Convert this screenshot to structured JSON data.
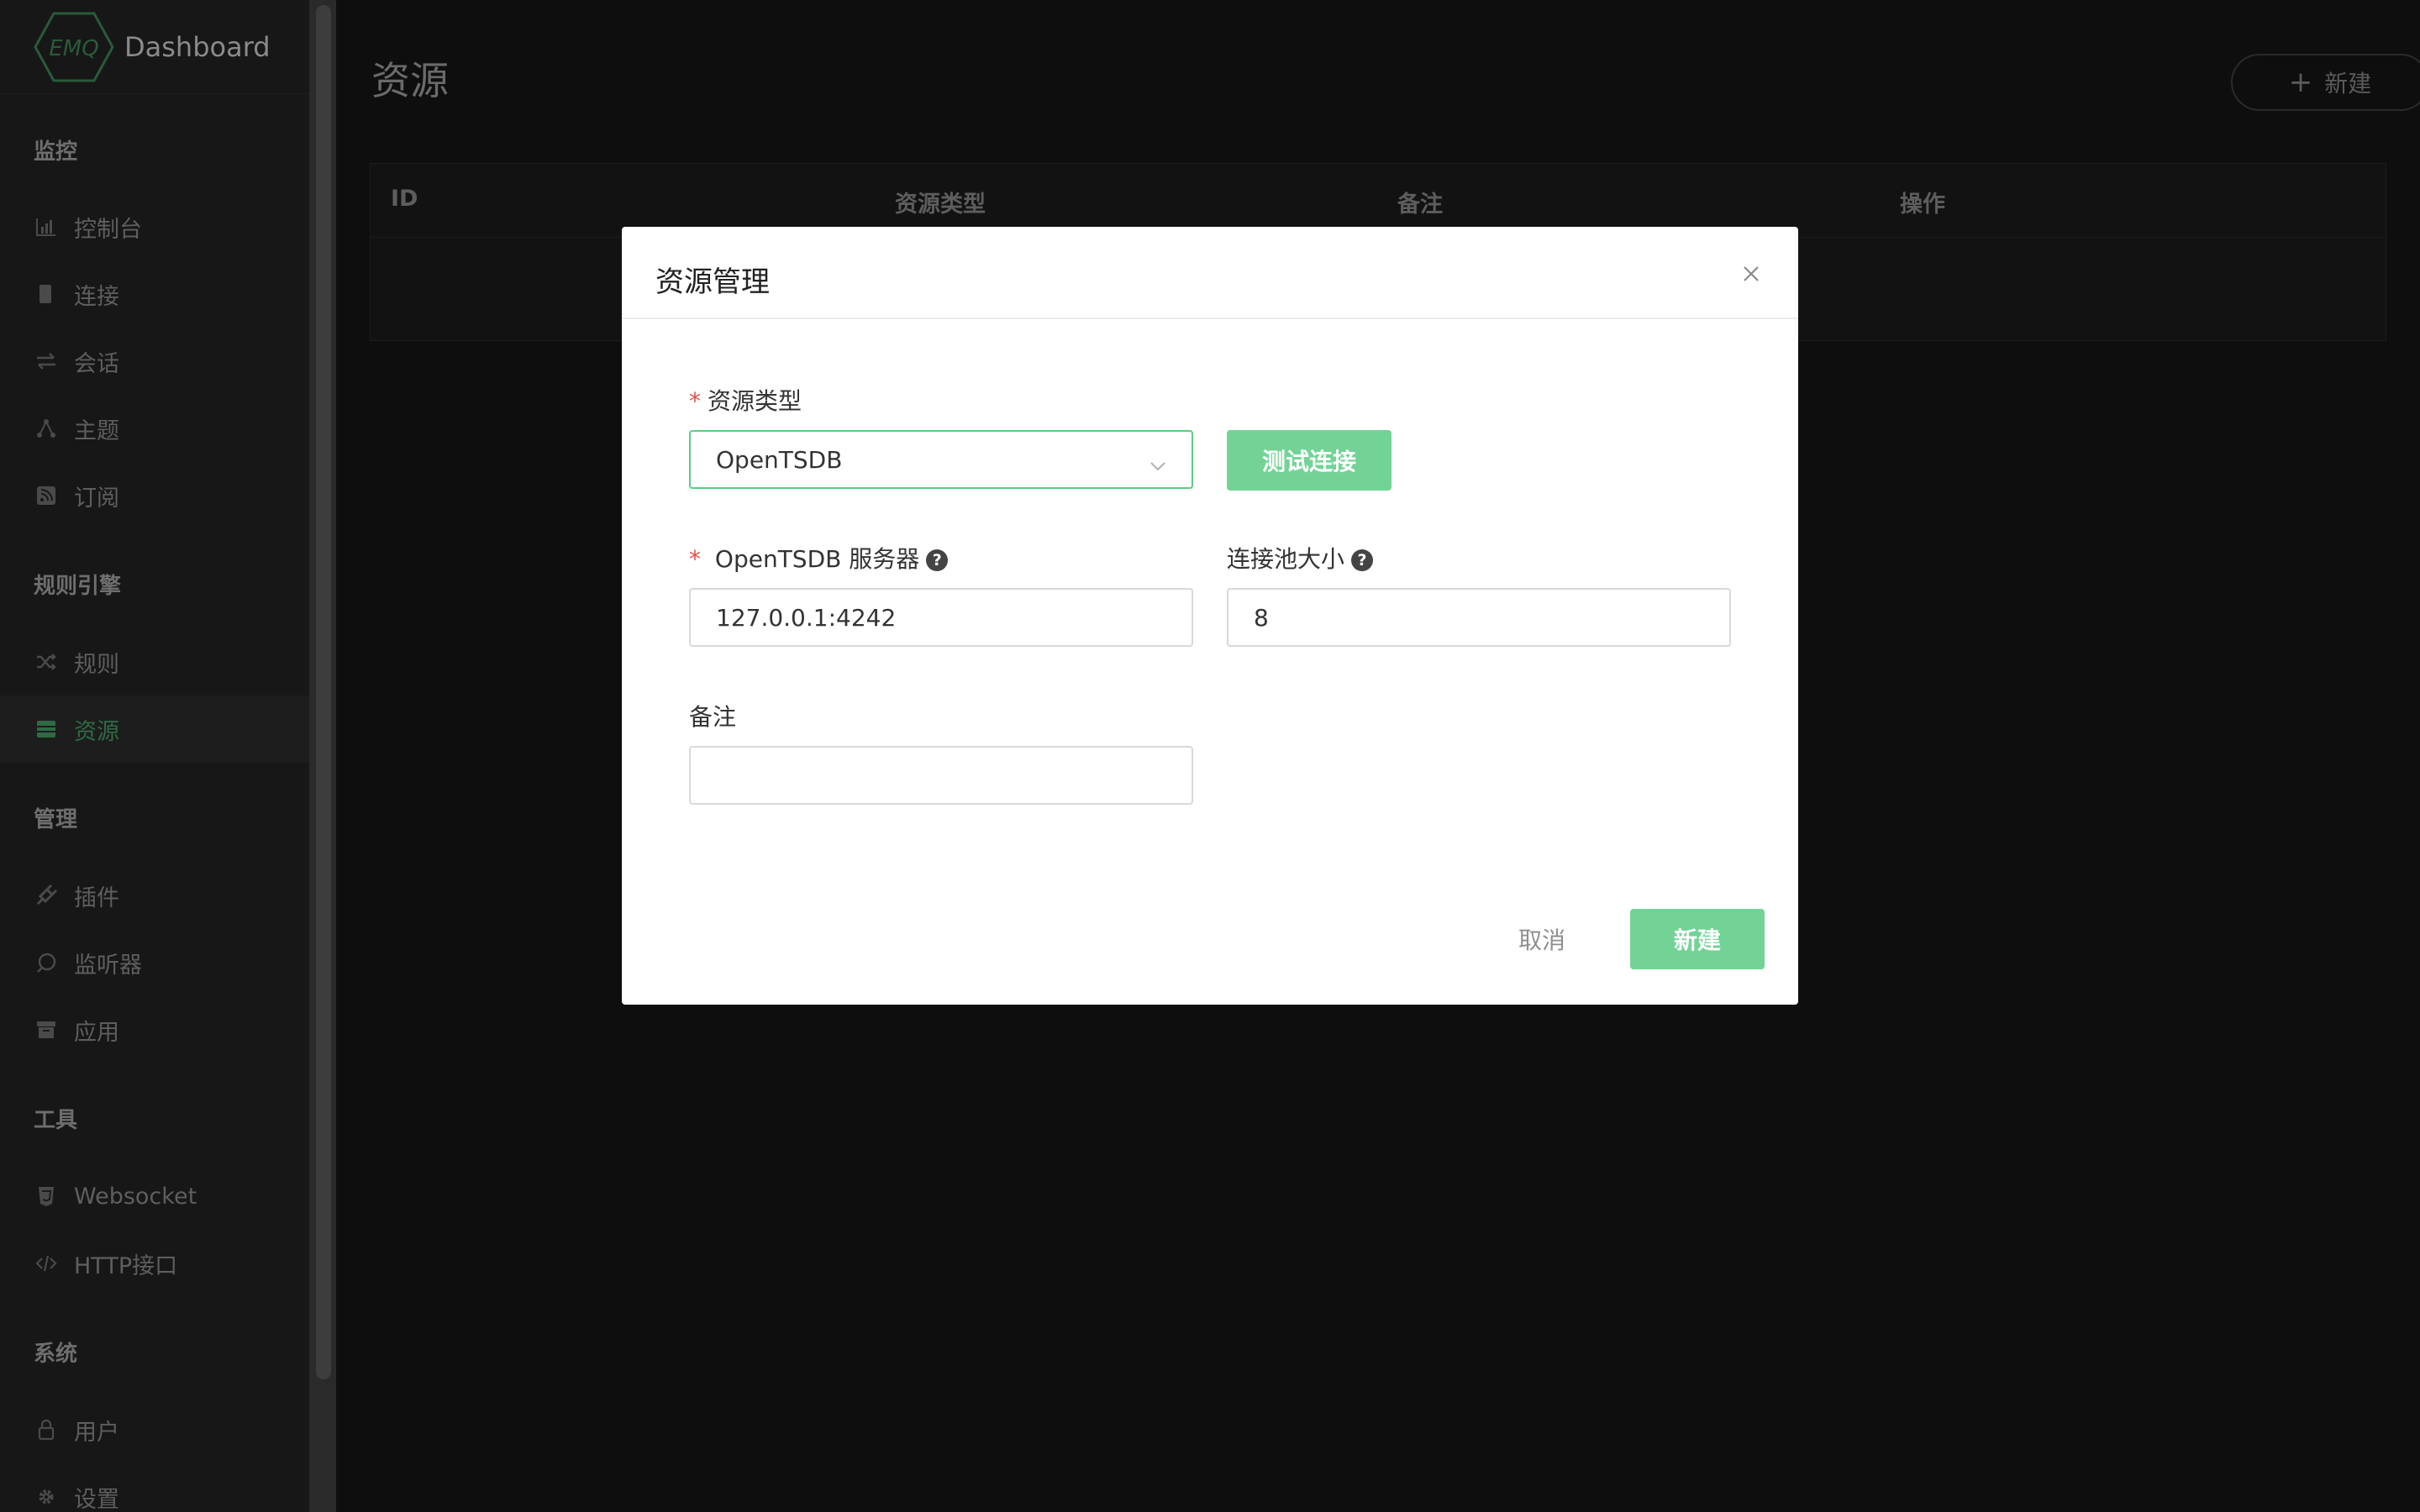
{
  "brand": {
    "logo_text": "EMQ",
    "name": "Dashboard"
  },
  "sidebar": {
    "sections": [
      {
        "title": "监控"
      },
      {
        "title": "规则引擎"
      },
      {
        "title": "管理"
      },
      {
        "title": "工具"
      },
      {
        "title": "系统"
      }
    ],
    "items": [
      {
        "label": "控制台",
        "icon": "bar-chart-icon"
      },
      {
        "label": "连接",
        "icon": "device-icon"
      },
      {
        "label": "会话",
        "icon": "swap-icon"
      },
      {
        "label": "主题",
        "icon": "topic-icon"
      },
      {
        "label": "订阅",
        "icon": "rss-icon"
      },
      {
        "label": "规则",
        "icon": "shuffle-icon"
      },
      {
        "label": "资源",
        "icon": "database-icon",
        "active": true
      },
      {
        "label": "插件",
        "icon": "plug-icon"
      },
      {
        "label": "监听器",
        "icon": "listener-icon"
      },
      {
        "label": "应用",
        "icon": "app-icon"
      },
      {
        "label": "Websocket",
        "icon": "html5-icon"
      },
      {
        "label": "HTTP接口",
        "icon": "code-icon"
      },
      {
        "label": "用户",
        "icon": "lock-icon"
      },
      {
        "label": "设置",
        "icon": "gear-icon"
      }
    ]
  },
  "page": {
    "title": "资源",
    "new_button": "新建",
    "table_headers": [
      "ID",
      "资源类型",
      "备注",
      "操作"
    ]
  },
  "modal": {
    "title": "资源管理",
    "resource_type_label": "资源类型",
    "resource_type_value": "OpenTSDB",
    "test_button": "测试连接",
    "server_label": "OpenTSDB 服务器",
    "server_value": "127.0.0.1:4242",
    "pool_label": "连接池大小",
    "pool_value": "8",
    "remark_label": "备注",
    "remark_value": "",
    "cancel_button": "取消",
    "create_button": "新建"
  },
  "colors": {
    "accent": "#73d396",
    "required": "#e6504d",
    "sidebar_bg": "#171717",
    "main_bg": "#0e0e0e"
  }
}
